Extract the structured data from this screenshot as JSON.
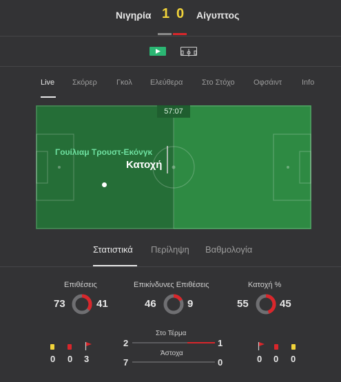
{
  "header": {
    "home_team": "Νιγηρία",
    "away_team": "Αίγυπτος",
    "home_score": "1",
    "away_score": "0"
  },
  "views": [
    {
      "name": "video-icon",
      "active": true
    },
    {
      "name": "pitch-icon",
      "active": false
    }
  ],
  "tabs": [
    "Live",
    "Σκόρερ",
    "Γκολ",
    "Ελεύθερα",
    "Στο Στόχο",
    "Οφσάιντ",
    "Info"
  ],
  "pitch": {
    "clock": "57:07",
    "player": "Γουίλιαμ Τρουστ-Εκόνγκ",
    "event": "Κατοχή"
  },
  "subtabs": [
    "Στατιστικά",
    "Περίληψη",
    "Βαθμολογία"
  ],
  "stats": {
    "attacks": {
      "label": "Επιθέσεις",
      "home": "73",
      "away": "41"
    },
    "dangerous_attacks": {
      "label": "Επικίνδυνες Επιθέσεις",
      "home": "46",
      "away": "9"
    },
    "possession": {
      "label": "Κατοχή %",
      "home": "55",
      "away": "45"
    },
    "on_target": {
      "label": "Στο Τέρμα",
      "home": "2",
      "away": "1"
    },
    "off_target": {
      "label": "Άστοχα",
      "home": "7",
      "away": "0"
    },
    "home_cards": {
      "yellow": "0",
      "red": "0",
      "corners": "3"
    },
    "away_cards": {
      "corners": "0",
      "red": "0",
      "yellow": "0"
    }
  },
  "colors": {
    "accent_yellow": "#f2d43a",
    "home_bar": "#8a8a8a",
    "away_bar": "#d9262b",
    "pitch_light": "#2e8a43",
    "pitch_dark": "#256e37"
  }
}
